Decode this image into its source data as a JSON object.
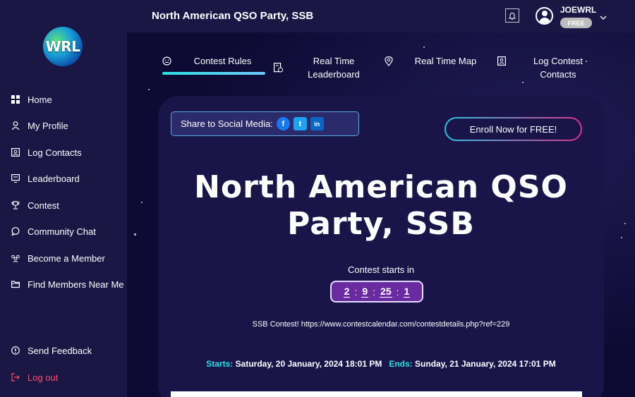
{
  "header": {
    "title": "North American QSO Party, SSB",
    "username": "JOEWRL",
    "plan_badge": "FREE"
  },
  "logo": {
    "text": "WRL"
  },
  "sidebar": {
    "items": [
      {
        "label": "Home",
        "icon": "grid-icon"
      },
      {
        "label": "My Profile",
        "icon": "user-icon"
      },
      {
        "label": "Log Contacts",
        "icon": "contact-card-icon"
      },
      {
        "label": "Leaderboard",
        "icon": "leaderboard-icon"
      },
      {
        "label": "Contest",
        "icon": "trophy-icon"
      },
      {
        "label": "Community Chat",
        "icon": "chat-icon"
      },
      {
        "label": "Become a Member",
        "icon": "members-icon"
      },
      {
        "label": "Find Members Near Me",
        "icon": "folder-icon"
      }
    ],
    "feedback": "Send Feedback",
    "logout": "Log out"
  },
  "tabs": [
    {
      "label": "Contest Rules",
      "icon": "rules-icon",
      "active": true
    },
    {
      "label": "Real Time\nLeaderboard",
      "icon": "leaderboard-doc-icon"
    },
    {
      "label": "Real Time Map",
      "icon": "map-pin-icon"
    },
    {
      "label": "Log Contest Contacts",
      "icon": "contact-log-icon"
    }
  ],
  "share": {
    "label": "Share to Social Media:",
    "networks": [
      {
        "name": "facebook",
        "glyph": "f",
        "color": "#1877f2"
      },
      {
        "name": "twitter",
        "glyph": "t",
        "color": "#1da1f2"
      },
      {
        "name": "linkedin",
        "glyph": "in",
        "color": "#0a66c2"
      }
    ]
  },
  "enroll_label": "Enroll Now for FREE!",
  "contest": {
    "title": "North American QSO Party, SSB",
    "starts_in_label": "Contest starts in",
    "countdown": [
      "2",
      "9",
      "25",
      "1"
    ],
    "description": "SSB Contest! https://www.contestcalendar.com/contestdetails.php?ref=229",
    "starts_label": "Starts:",
    "starts_value": "Saturday, 20 January, 2024 18:01 PM",
    "ends_label": "Ends:",
    "ends_value": "Sunday, 21 January, 2024 17:01 PM"
  },
  "colors": {
    "accent_cyan": "#2ee2e2",
    "logout_red": "#ff4d6b",
    "countdown_bg": "#6a2aa0"
  }
}
